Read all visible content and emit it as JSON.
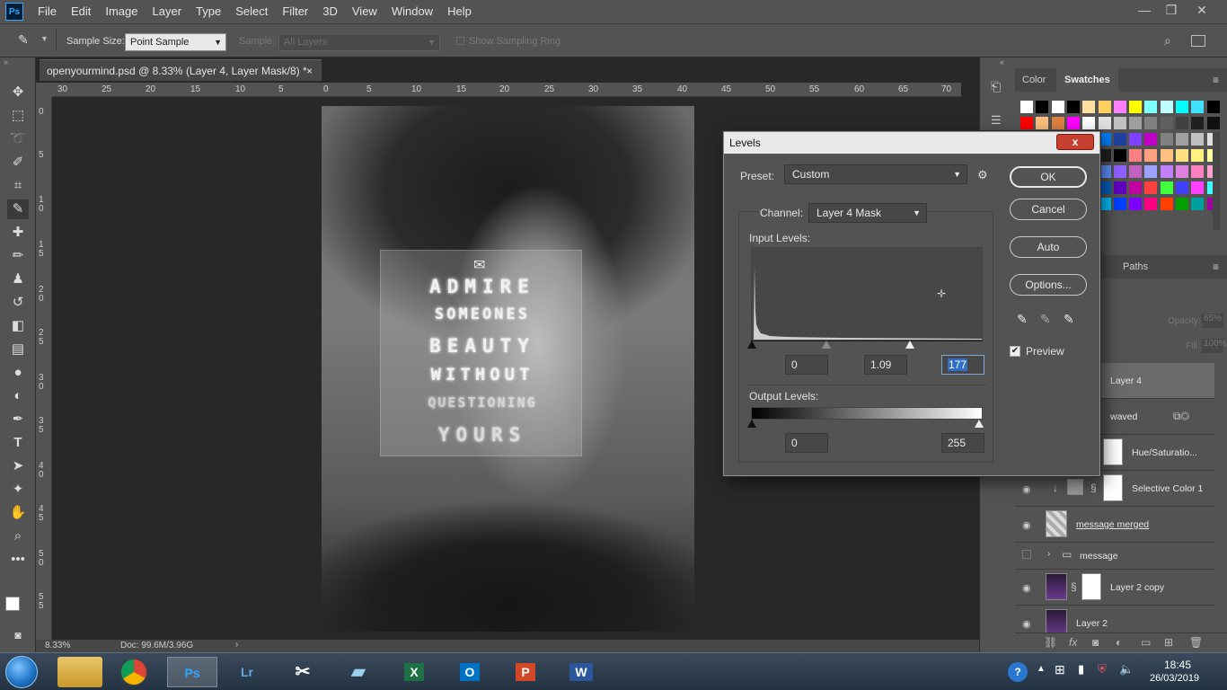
{
  "app": {
    "logo": "Ps",
    "menus": [
      "File",
      "Edit",
      "Image",
      "Layer",
      "Type",
      "Select",
      "Filter",
      "3D",
      "View",
      "Window",
      "Help"
    ]
  },
  "options": {
    "sample_size_label": "Sample Size:",
    "sample_size_value": "Point Sample",
    "sample_label": "Sample:",
    "sample_value": "All Layers",
    "show_ring_label": "Show Sampling Ring"
  },
  "document": {
    "tab_title": "openyourmind.psd @ 8.33% (Layer 4, Layer Mask/8) *",
    "close": "×",
    "zoom": "8.33%",
    "doc_info": "Doc: 99.6M/3.96G"
  },
  "ruler_h": [
    "30",
    "25",
    "20",
    "15",
    "10",
    "5",
    "0",
    "5",
    "10",
    "15",
    "20",
    "25",
    "30",
    "35",
    "40",
    "45",
    "50",
    "55",
    "60",
    "65",
    "70"
  ],
  "ruler_v": [
    "0",
    "5",
    "1\n0",
    "1\n5",
    "2\n0",
    "2\n5",
    "3\n0",
    "3\n5",
    "4\n0",
    "4\n5",
    "5\n0",
    "5\n5"
  ],
  "canvas_text": [
    "ADMIRE",
    "SOMEONES",
    "BEAUTY",
    "WITHOUT",
    "QUESTIONING",
    "YOURS"
  ],
  "panels": {
    "color_tab": "Color",
    "swatches_tab": "Swatches",
    "paths_tab": "Paths",
    "opacity_label": "Opacity:",
    "opacity_value": "65%",
    "fill_label": "Fill:",
    "fill_value": "100%",
    "layers": [
      {
        "name": "Layer 4"
      },
      {
        "name": "waved"
      },
      {
        "name": "Hue/Saturatio..."
      },
      {
        "name": "Selective Color 1"
      },
      {
        "name": "message merged"
      },
      {
        "name": "message"
      },
      {
        "name": "Layer 2 copy"
      },
      {
        "name": "Layer 2"
      }
    ]
  },
  "levels": {
    "title": "Levels",
    "close": "x",
    "preset_label": "Preset:",
    "preset_value": "Custom",
    "channel_label": "Channel:",
    "channel_value": "Layer 4 Mask",
    "input_label": "Input Levels:",
    "input_black": "0",
    "input_gamma": "1.09",
    "input_white": "177",
    "output_label": "Output Levels:",
    "output_black": "0",
    "output_white": "255",
    "ok": "OK",
    "cancel": "Cancel",
    "auto": "Auto",
    "options": "Options...",
    "preview": "Preview"
  },
  "taskbar": {
    "time": "18:45",
    "date": "26/03/2019",
    "apps": [
      "Ps",
      "Lr",
      "X",
      "O",
      "P",
      "W"
    ]
  },
  "colors": {
    "accent": "#31a8ff",
    "panel": "#535353",
    "canvas": "#282828"
  }
}
